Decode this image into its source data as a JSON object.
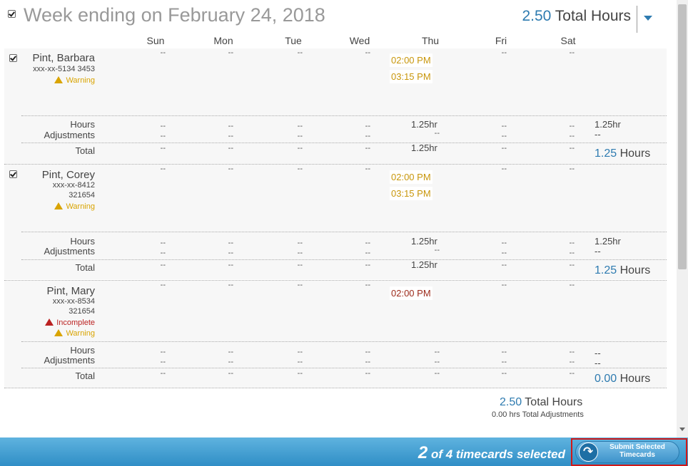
{
  "header": {
    "title": "Week ending on February 24, 2018",
    "total_num": "2.50",
    "total_label": " Total Hours"
  },
  "days": [
    "Sun",
    "Mon",
    "Tue",
    "Wed",
    "Thu",
    "Fri",
    "Sat"
  ],
  "dash": "--",
  "labels": {
    "hours": "Hours",
    "adjustments": "Adjustments",
    "total": "Total",
    "warning": "Warning",
    "incomplete": "Incomplete",
    "hours_unit": " Hours"
  },
  "employees": [
    {
      "name": "Pint, Barbara",
      "id_line": "xxx-xx-5134 3453",
      "punch_in": "02:00 PM",
      "punch_out": "03:15 PM",
      "thu_hours": "1.25hr",
      "week_hours": "1.25hr",
      "total_num": "1.25",
      "checked": true
    },
    {
      "name": "Pint, Corey",
      "id_line": "xxx-xx-8412",
      "id_line2": "321654",
      "punch_in": "02:00 PM",
      "punch_out": "03:15 PM",
      "thu_hours": "1.25hr",
      "week_hours": "1.25hr",
      "total_num": "1.25",
      "checked": true
    },
    {
      "name": "Pint, Mary",
      "id_line": "xxx-xx-8534",
      "id_line2": "321654",
      "punch_in": "02:00 PM",
      "total_num": "0.00",
      "checked": false
    }
  ],
  "grand": {
    "total_num": "2.50",
    "total_label": " Total Hours",
    "adjustments": "0.00 hrs Total Adjustments"
  },
  "footer": {
    "selected_count": "2",
    "selected_text": " of 4 timecards selected",
    "submit_label_1": "Submit Selected",
    "submit_label_2": "Timecards"
  }
}
